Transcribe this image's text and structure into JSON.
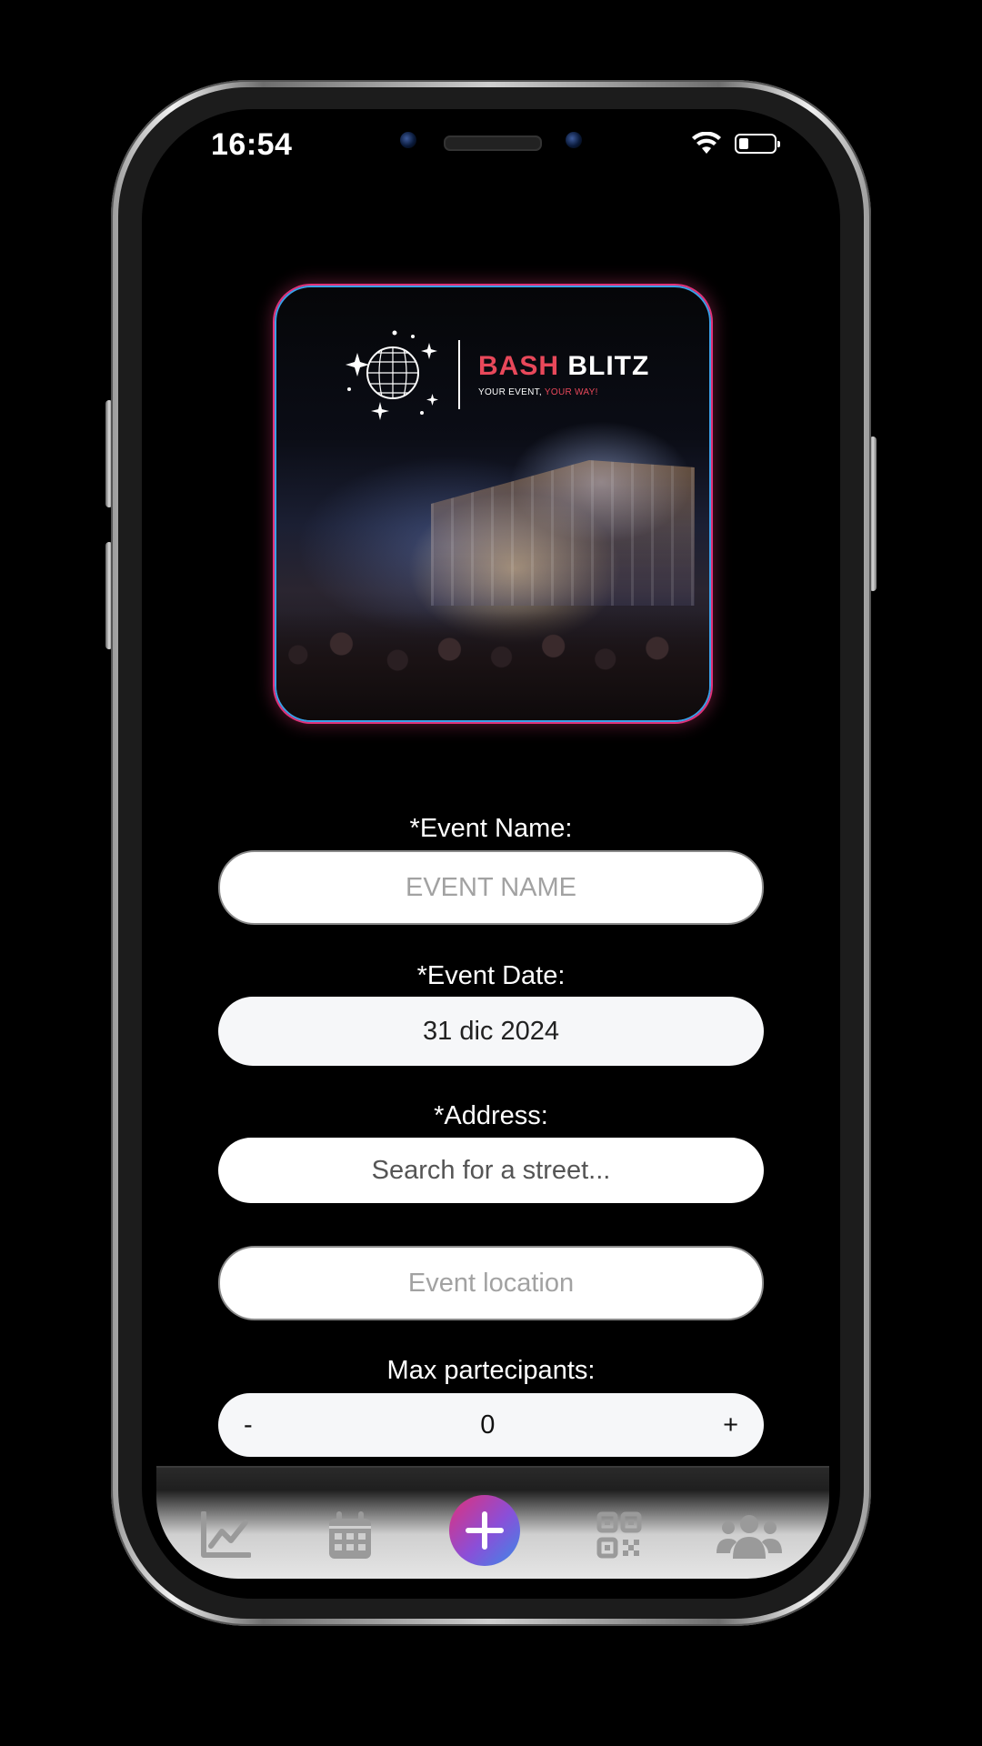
{
  "status_bar": {
    "time": "16:54"
  },
  "event_image": {
    "brand_name_part1": "BASH",
    "brand_name_part2": "BLITZ",
    "tagline_part1": "YOUR EVENT,",
    "tagline_part2": "YOUR WAY!"
  },
  "form": {
    "event_name": {
      "label": "*Event Name:",
      "placeholder": "EVENT NAME"
    },
    "event_date": {
      "label": "*Event Date:",
      "value": "31 dic 2024"
    },
    "address": {
      "label": "*Address:",
      "search_text": "Search for a street..."
    },
    "location": {
      "placeholder": "Event location"
    },
    "max_participants": {
      "label": "Max partecipants:",
      "minus": "-",
      "value": "0",
      "plus": "+"
    }
  },
  "tab_bar": {
    "items": [
      {
        "icon": "chart-line-icon"
      },
      {
        "icon": "calendar-icon"
      },
      {
        "icon": "plus-icon"
      },
      {
        "icon": "qr-code-icon"
      },
      {
        "icon": "users-icon"
      }
    ]
  },
  "colors": {
    "accent_pink": "#e0307a",
    "accent_blue": "#3a8ae8",
    "brand_red": "#e8485a"
  }
}
